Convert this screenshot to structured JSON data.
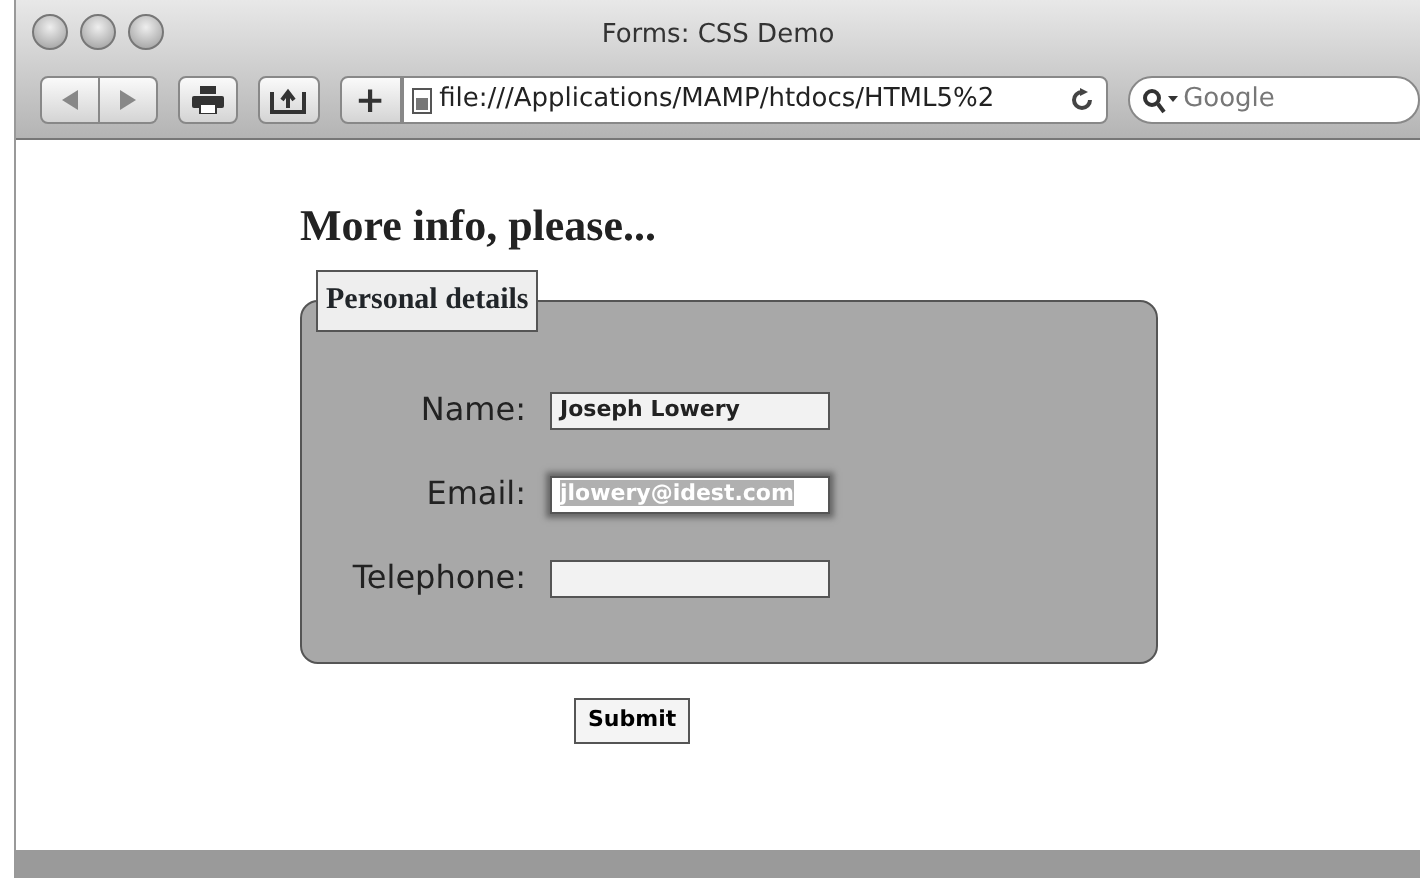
{
  "window": {
    "title": "Forms: CSS Demo"
  },
  "toolbar": {
    "address": "file:///Applications/MAMP/htdocs/HTML5%2",
    "search_placeholder": "Google",
    "new_tab_label": "+"
  },
  "page": {
    "heading": "More info, please...",
    "legend": "Personal details",
    "fields": [
      {
        "label": "Name:",
        "value": "Joseph Lowery",
        "focused": false
      },
      {
        "label": "Email:",
        "value": "jlowery@idest.com",
        "focused": true
      },
      {
        "label": "Telephone:",
        "focused": false
      }
    ],
    "submit": "Submit"
  }
}
